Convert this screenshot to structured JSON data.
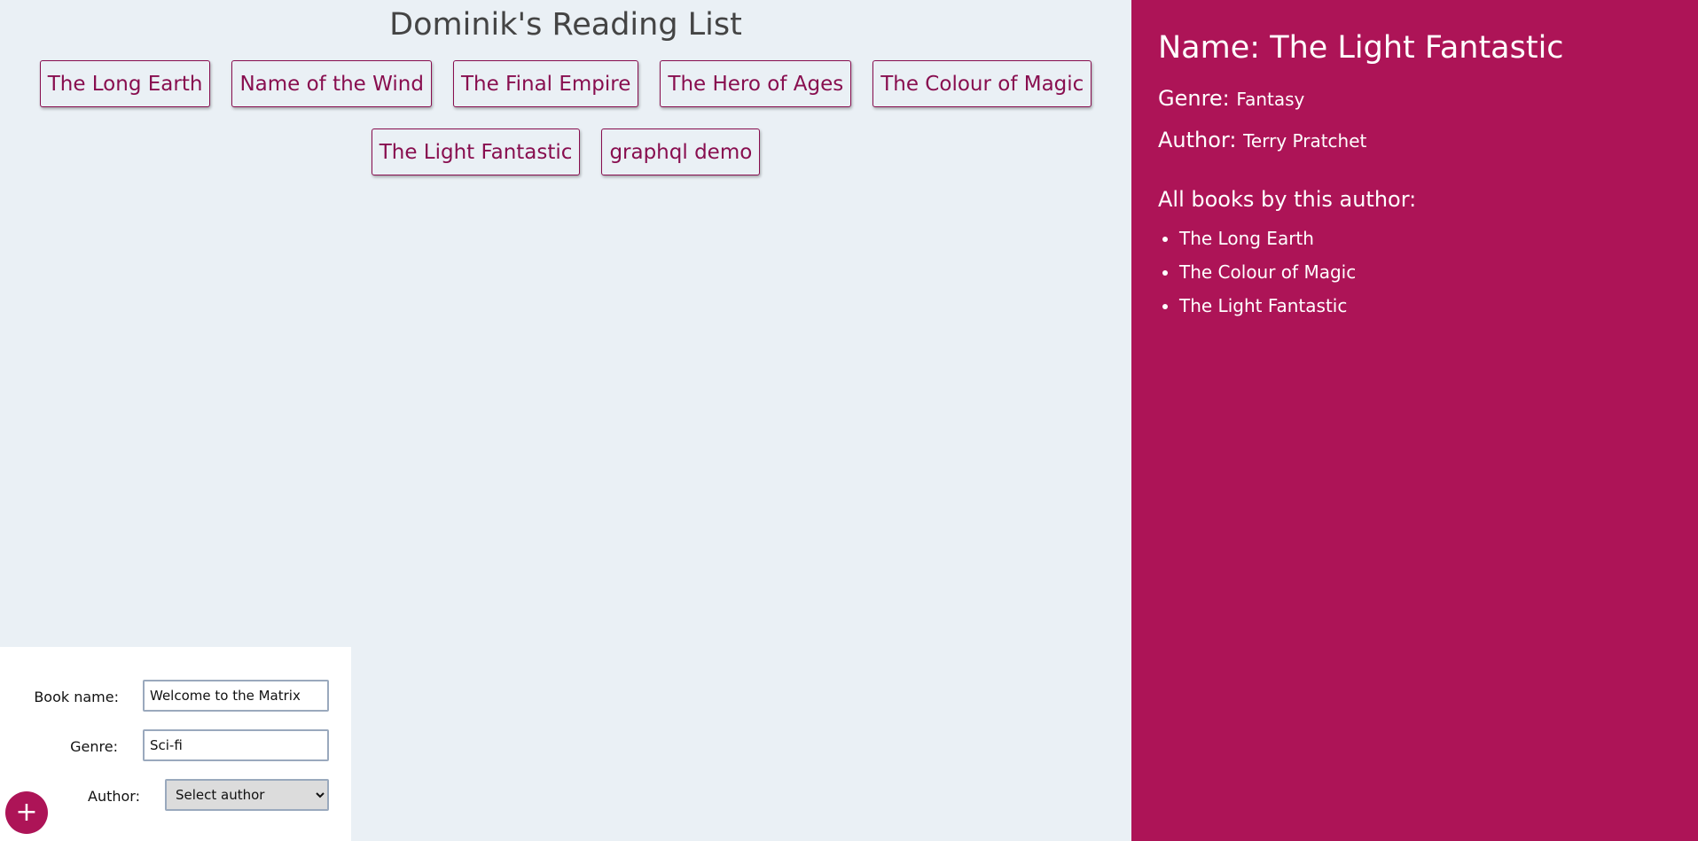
{
  "header": {
    "title": "Dominik's Reading List"
  },
  "books": [
    {
      "label": "The Long Earth"
    },
    {
      "label": "Name of the Wind"
    },
    {
      "label": "The Final Empire"
    },
    {
      "label": "The Hero of Ages"
    },
    {
      "label": "The Colour of Magic"
    },
    {
      "label": "The Light Fantastic"
    },
    {
      "label": "graphql demo"
    }
  ],
  "details": {
    "name_label": "Name:",
    "name_value": "The Light Fantastic",
    "genre_label": "Genre:",
    "genre_value": "Fantasy",
    "author_label": "Author:",
    "author_value": "Terry Pratchet",
    "all_books_label": "All books by this author:",
    "author_books": [
      "The Long Earth",
      "The Colour of Magic",
      "The Light Fantastic"
    ]
  },
  "form": {
    "book_name_label": "Book name:",
    "book_name_value": "Welcome to the Matrix",
    "genre_label": "Genre:",
    "genre_value": "Sci-fi",
    "author_label": "Author:",
    "author_selected": "Select author",
    "add_button_label": "+"
  },
  "colors": {
    "accent": "#ad1457",
    "accent_dark": "#880e4f",
    "background": "#eaf0f5"
  },
  "icons": {
    "add": "plus-icon"
  }
}
